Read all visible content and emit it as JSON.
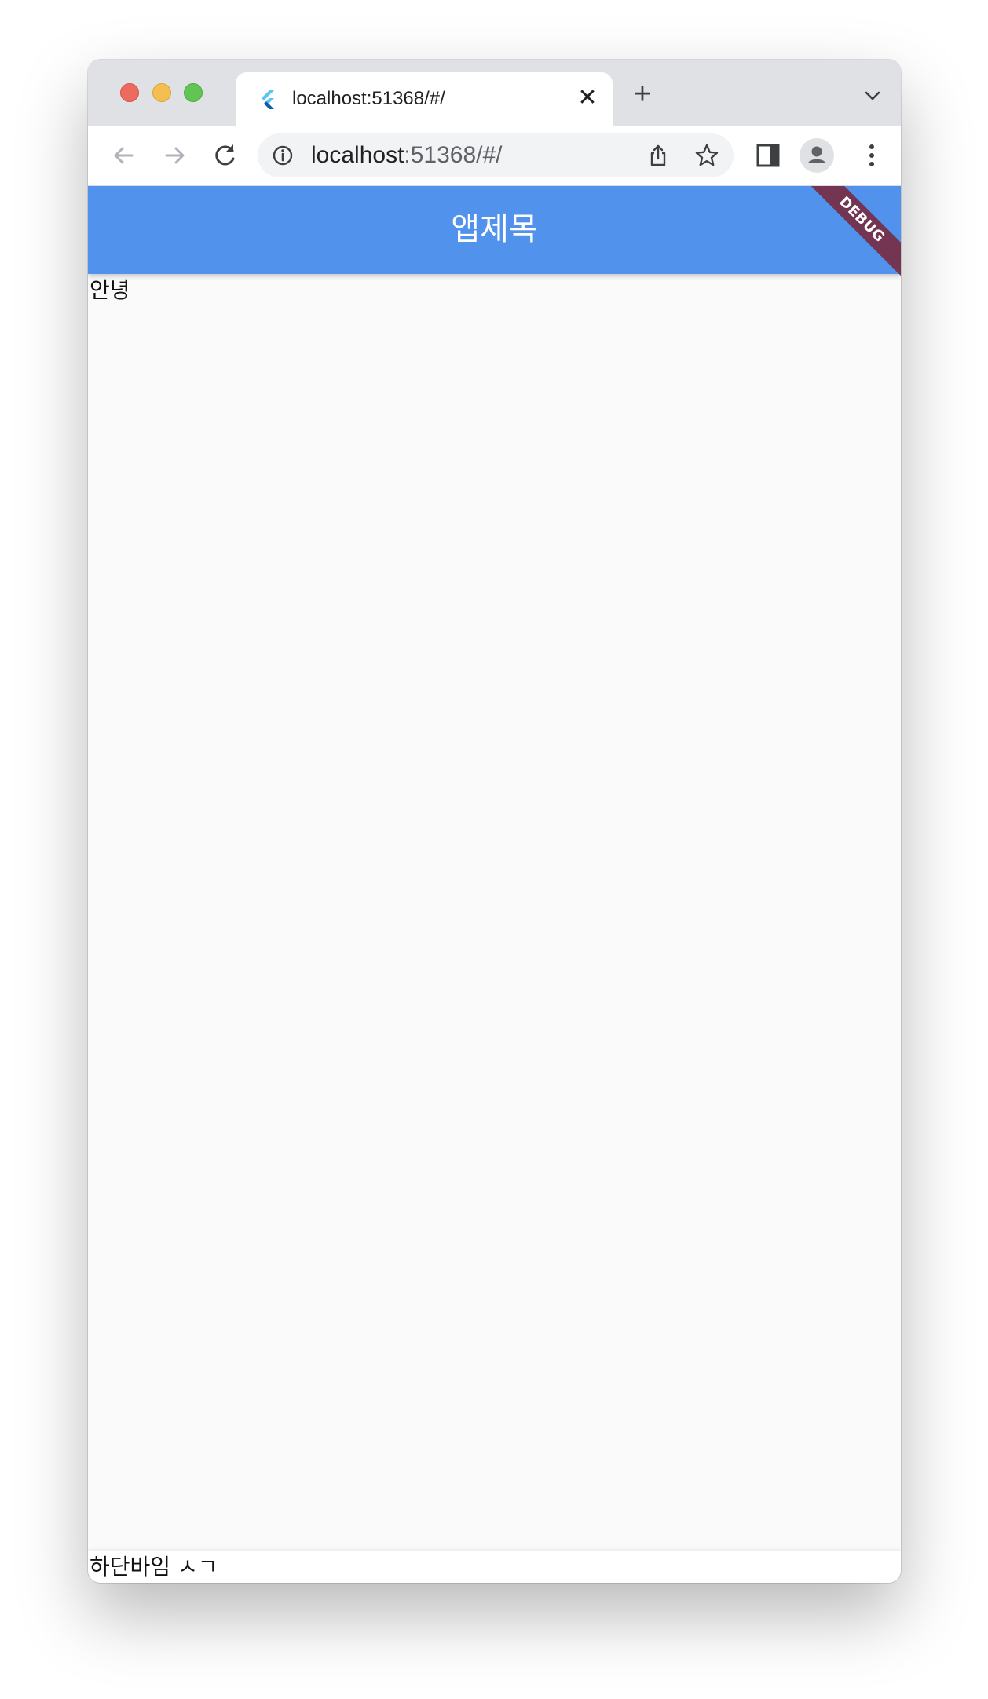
{
  "browser": {
    "tab": {
      "title": "localhost:51368/#/",
      "favicon": "flutter-icon"
    },
    "address_bar": {
      "host": "localhost",
      "path": ":51368/#/"
    },
    "icons": {
      "back": "arrow-left-icon",
      "forward": "arrow-right-icon",
      "reload": "reload-icon",
      "site_info": "info-icon",
      "share": "share-icon",
      "bookmark": "star-icon",
      "side_panel": "side-panel-icon",
      "profile": "profile-icon",
      "menu": "kebab-menu-icon",
      "close_tab": "close-icon",
      "new_tab": "plus-icon",
      "tab_list": "chevron-down-icon"
    }
  },
  "app": {
    "appbar_title": "앱제목",
    "appbar_color": "#5092ec",
    "debug_banner": "DEBUG",
    "body_text": "안녕",
    "bottom_text": "하단바임 ㅅㄱ"
  }
}
